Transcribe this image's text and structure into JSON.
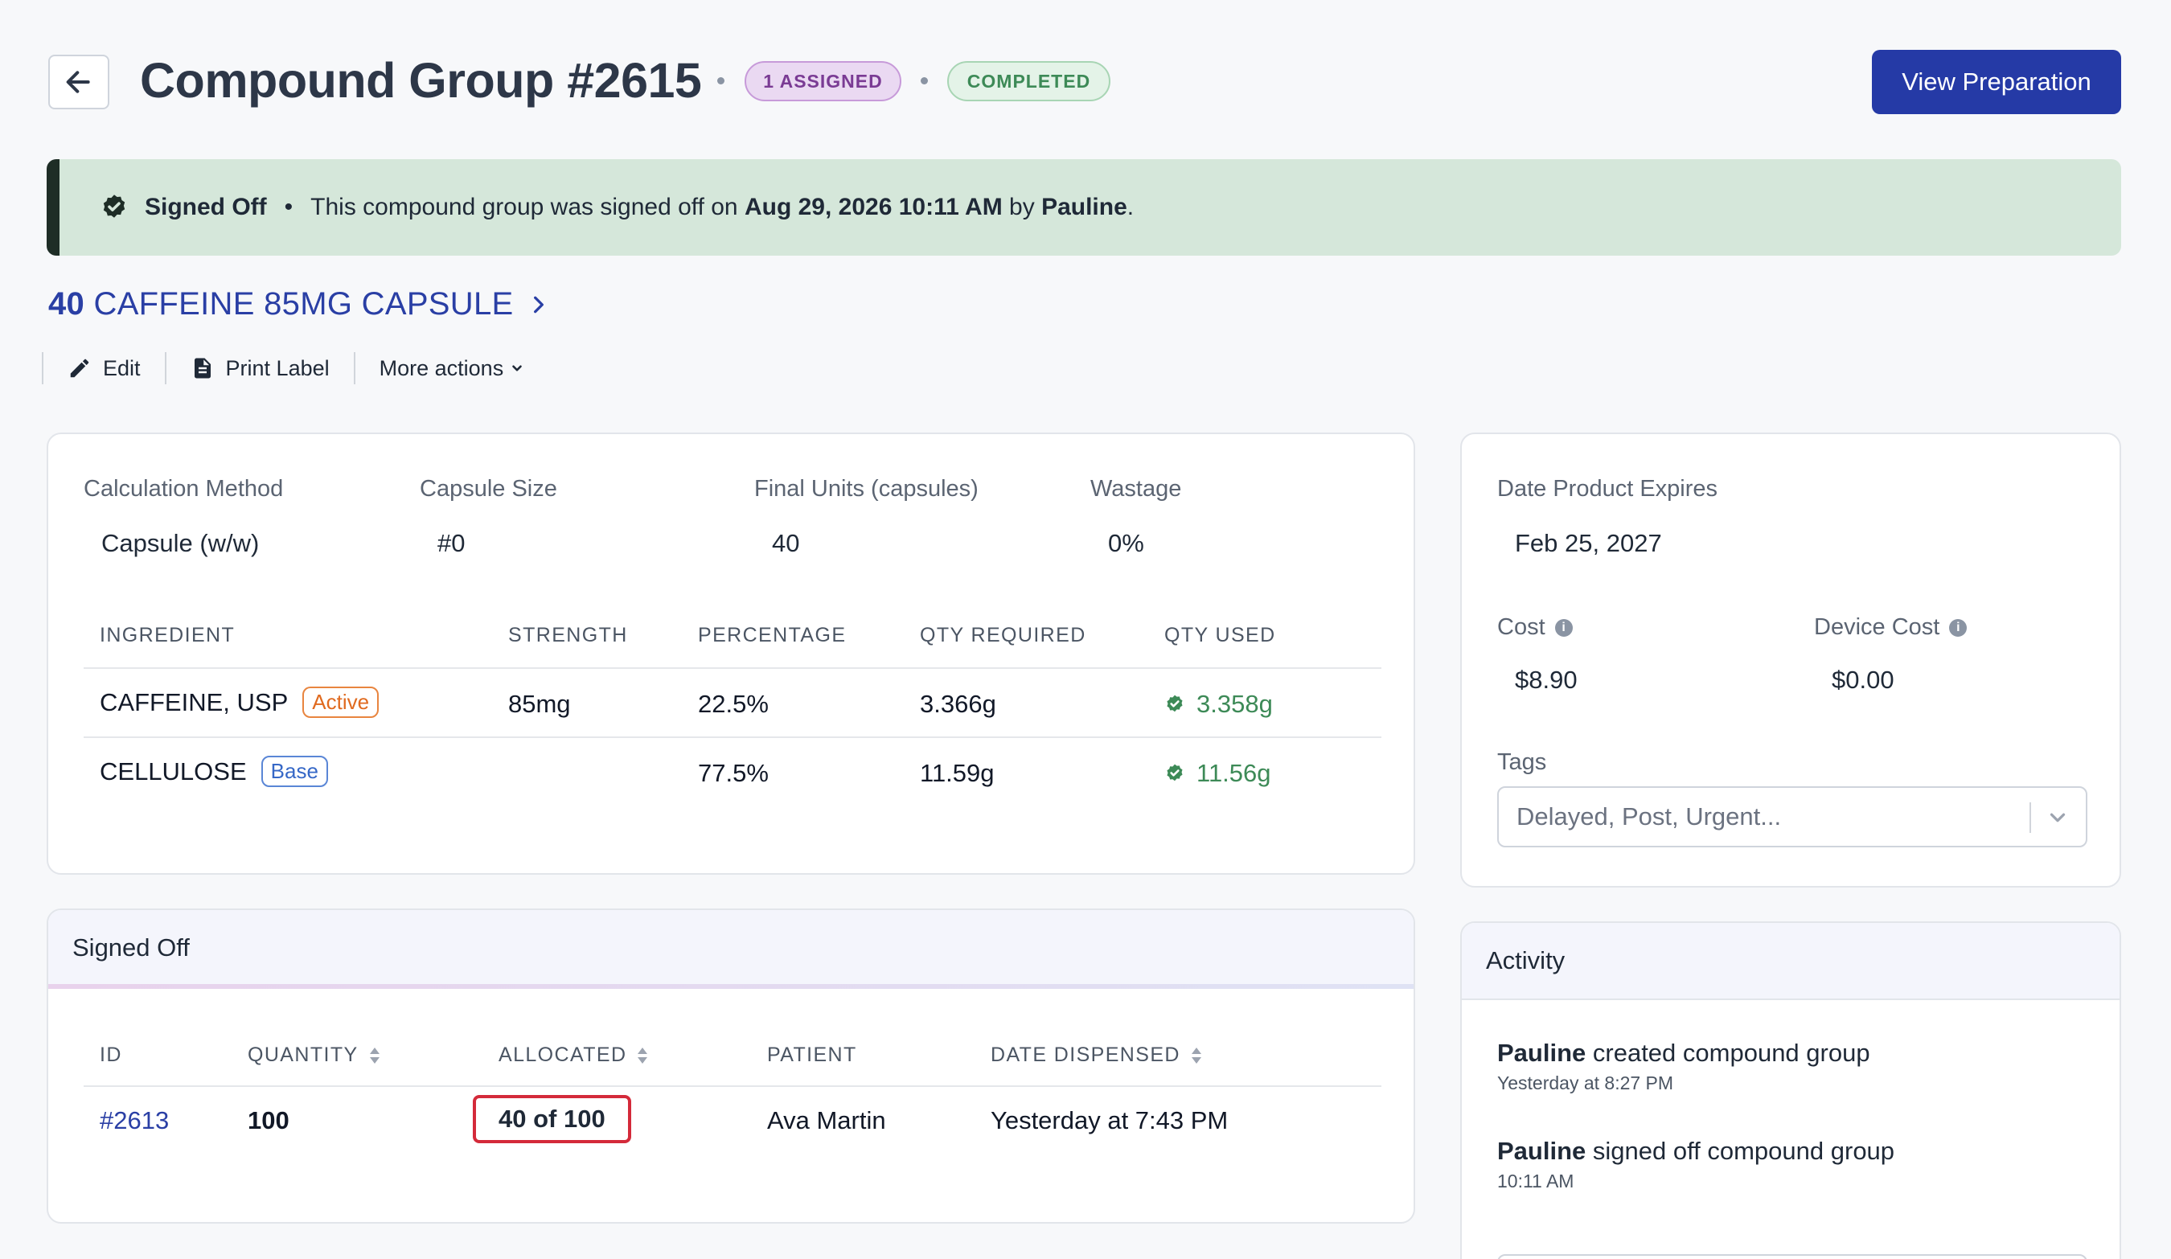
{
  "header": {
    "title": "Compound Group #2615",
    "assigned_badge": "1 ASSIGNED",
    "status_badge": "COMPLETED",
    "view_preparation": "View Preparation"
  },
  "banner": {
    "label": "Signed Off",
    "text_before": "This compound group was signed off on",
    "date": "Aug 29, 2026 10:11 AM",
    "by": "by",
    "user": "Pauline",
    "period": "."
  },
  "product": {
    "quantity": "40",
    "name": "CAFFEINE 85MG CAPSULE"
  },
  "actions": {
    "edit": "Edit",
    "print_label": "Print Label",
    "more_actions": "More actions"
  },
  "summary": {
    "calc_method_label": "Calculation Method",
    "calc_method_value": "Capsule (w/w)",
    "capsule_size_label": "Capsule Size",
    "capsule_size_value": "#0",
    "final_units_label": "Final Units (capsules)",
    "final_units_value": "40",
    "wastage_label": "Wastage",
    "wastage_value": "0%"
  },
  "ingredients": {
    "headers": [
      "INGREDIENT",
      "STRENGTH",
      "PERCENTAGE",
      "QTY REQUIRED",
      "QTY USED"
    ],
    "rows": [
      {
        "name": "CAFFEINE, USP",
        "tag": "Active",
        "strength": "85mg",
        "percentage": "22.5%",
        "qty_required": "3.366g",
        "qty_used": "3.358g"
      },
      {
        "name": "CELLULOSE",
        "tag": "Base",
        "strength": "",
        "percentage": "77.5%",
        "qty_required": "11.59g",
        "qty_used": "11.56g"
      }
    ]
  },
  "side": {
    "expires_label": "Date Product Expires",
    "expires_value": "Feb 25, 2027",
    "cost_label": "Cost",
    "cost_value": "$8.90",
    "device_cost_label": "Device Cost",
    "device_cost_value": "$0.00",
    "tags_label": "Tags",
    "tags_placeholder": "Delayed, Post, Urgent..."
  },
  "signed_off": {
    "title": "Signed Off",
    "headers": [
      "ID",
      "QUANTITY",
      "ALLOCATED",
      "PATIENT",
      "DATE DISPENSED"
    ],
    "row": {
      "id": "#2613",
      "quantity": "100",
      "allocated": "40 of 100",
      "patient": "Ava Martin",
      "date": "Yesterday at 7:43 PM"
    }
  },
  "activity": {
    "title": "Activity",
    "items": [
      {
        "user": "Pauline",
        "action": "created compound group",
        "time": "Yesterday at 8:27 PM"
      },
      {
        "user": "Pauline",
        "action": "signed off compound group",
        "time": "10:11 AM"
      }
    ]
  },
  "colors": {
    "primary": "#253aa6",
    "success": "#3d8a57",
    "highlight_border": "#d42a3a"
  }
}
